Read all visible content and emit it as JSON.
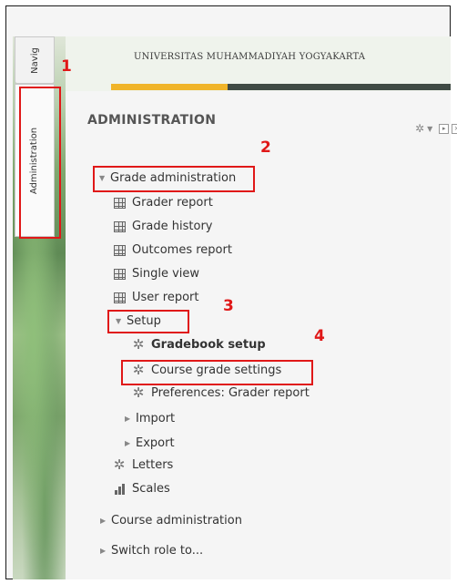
{
  "header": {
    "institution": "UNIVERSITAS MUHAMMADIYAH YOGYAKARTA"
  },
  "tabs": {
    "navigation": "Navig",
    "administration": "Administration"
  },
  "block": {
    "title": "ADMINISTRATION",
    "items": {
      "grade_admin": "Grade administration",
      "grader_report": "Grader report",
      "grade_history": "Grade history",
      "outcomes_report": "Outcomes report",
      "single_view": "Single view",
      "user_report": "User report",
      "setup": "Setup",
      "gradebook_setup": "Gradebook setup",
      "course_grade_settings": "Course grade settings",
      "preferences": "Preferences: Grader report",
      "import": "Import",
      "export": "Export",
      "letters": "Letters",
      "scales": "Scales",
      "course_admin": "Course administration",
      "switch_role": "Switch role to..."
    }
  },
  "annotations": {
    "n1": "1",
    "n2": "2",
    "n3": "3",
    "n4": "4"
  },
  "colors": {
    "annotation": "#e01818",
    "accent_yellow": "#f0b429",
    "header_dark": "#3f4a44"
  }
}
